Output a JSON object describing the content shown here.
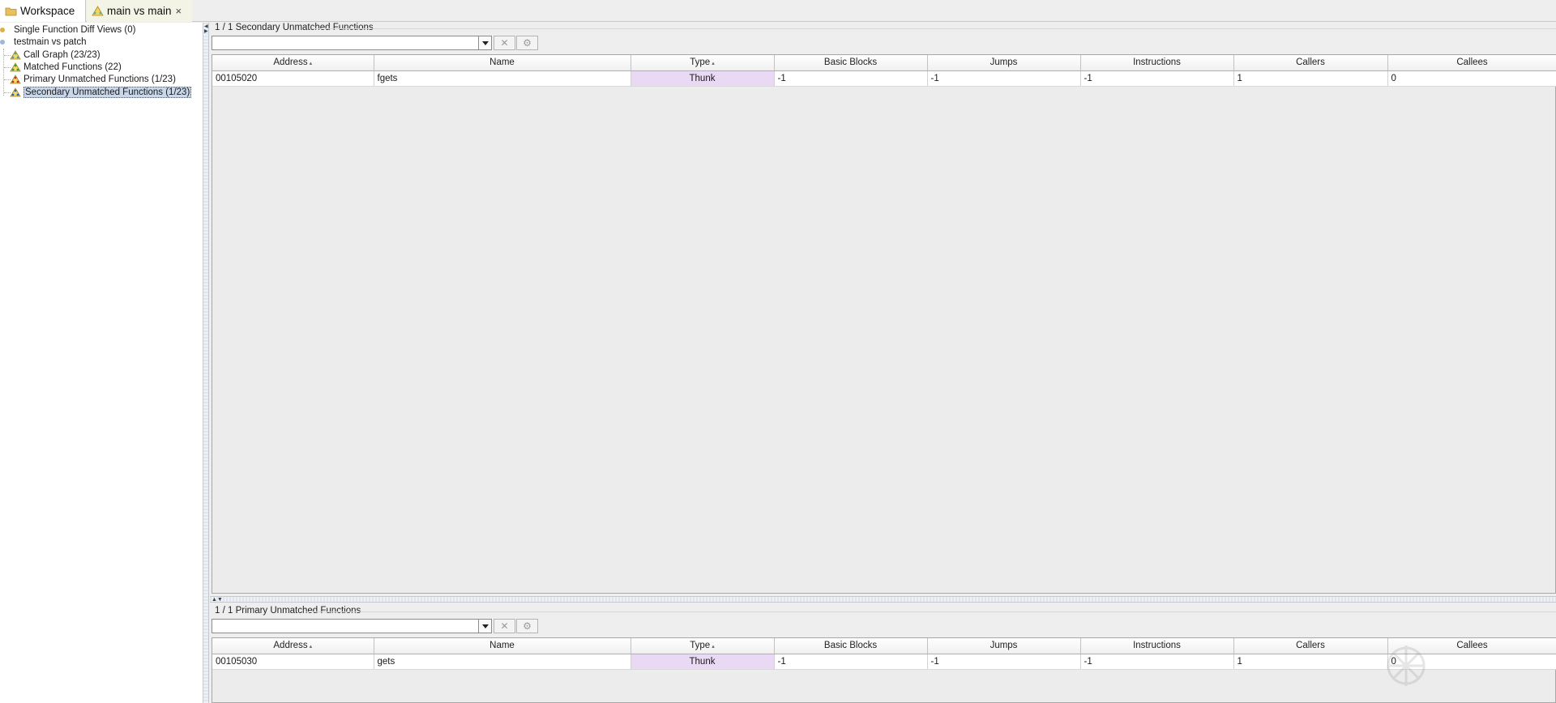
{
  "tabs": {
    "workspace": "Workspace",
    "diff": "main vs main",
    "close": "×"
  },
  "tree": {
    "single_function_diff_views": "Single Function Diff Views (0)",
    "project": "testmain vs patch",
    "call_graph": "Call Graph (23/23)",
    "matched": "Matched Functions (22)",
    "primary_unmatched": "Primary Unmatched Functions (1/23)",
    "secondary_unmatched": "Secondary Unmatched Functions (1/23)"
  },
  "secondary_panel": {
    "title": "1 / 1 Secondary Unmatched Functions",
    "filter_value": "",
    "columns": [
      "Address",
      "Name",
      "Type",
      "Basic Blocks",
      "Jumps",
      "Instructions",
      "Callers",
      "Callees"
    ],
    "rows": [
      [
        "00105020",
        "fgets",
        "Thunk",
        "-1",
        "-1",
        "-1",
        "1",
        "0"
      ]
    ]
  },
  "primary_panel": {
    "title": "1 / 1 Primary Unmatched Functions",
    "filter_value": "",
    "columns": [
      "Address",
      "Name",
      "Type",
      "Basic Blocks",
      "Jumps",
      "Instructions",
      "Callers",
      "Callees"
    ],
    "rows": [
      [
        "00105030",
        "gets",
        "Thunk",
        "-1",
        "-1",
        "-1",
        "1",
        "0"
      ]
    ]
  },
  "colors": {
    "type_cell_bg": "#ead9f4",
    "selection_bg": "#c8d8ea",
    "diff_tab_bg": "#f3f3e6"
  },
  "icons": {
    "workspace_tab": "folder-icon",
    "diff_tab": "graph-warning-icon",
    "call_graph": "graph-icon",
    "matched": "graph-green-icon",
    "primary": "graph-red-icon",
    "secondary": "graph-blue-icon",
    "clear": "clear-x-icon",
    "settings": "gear-icon"
  }
}
